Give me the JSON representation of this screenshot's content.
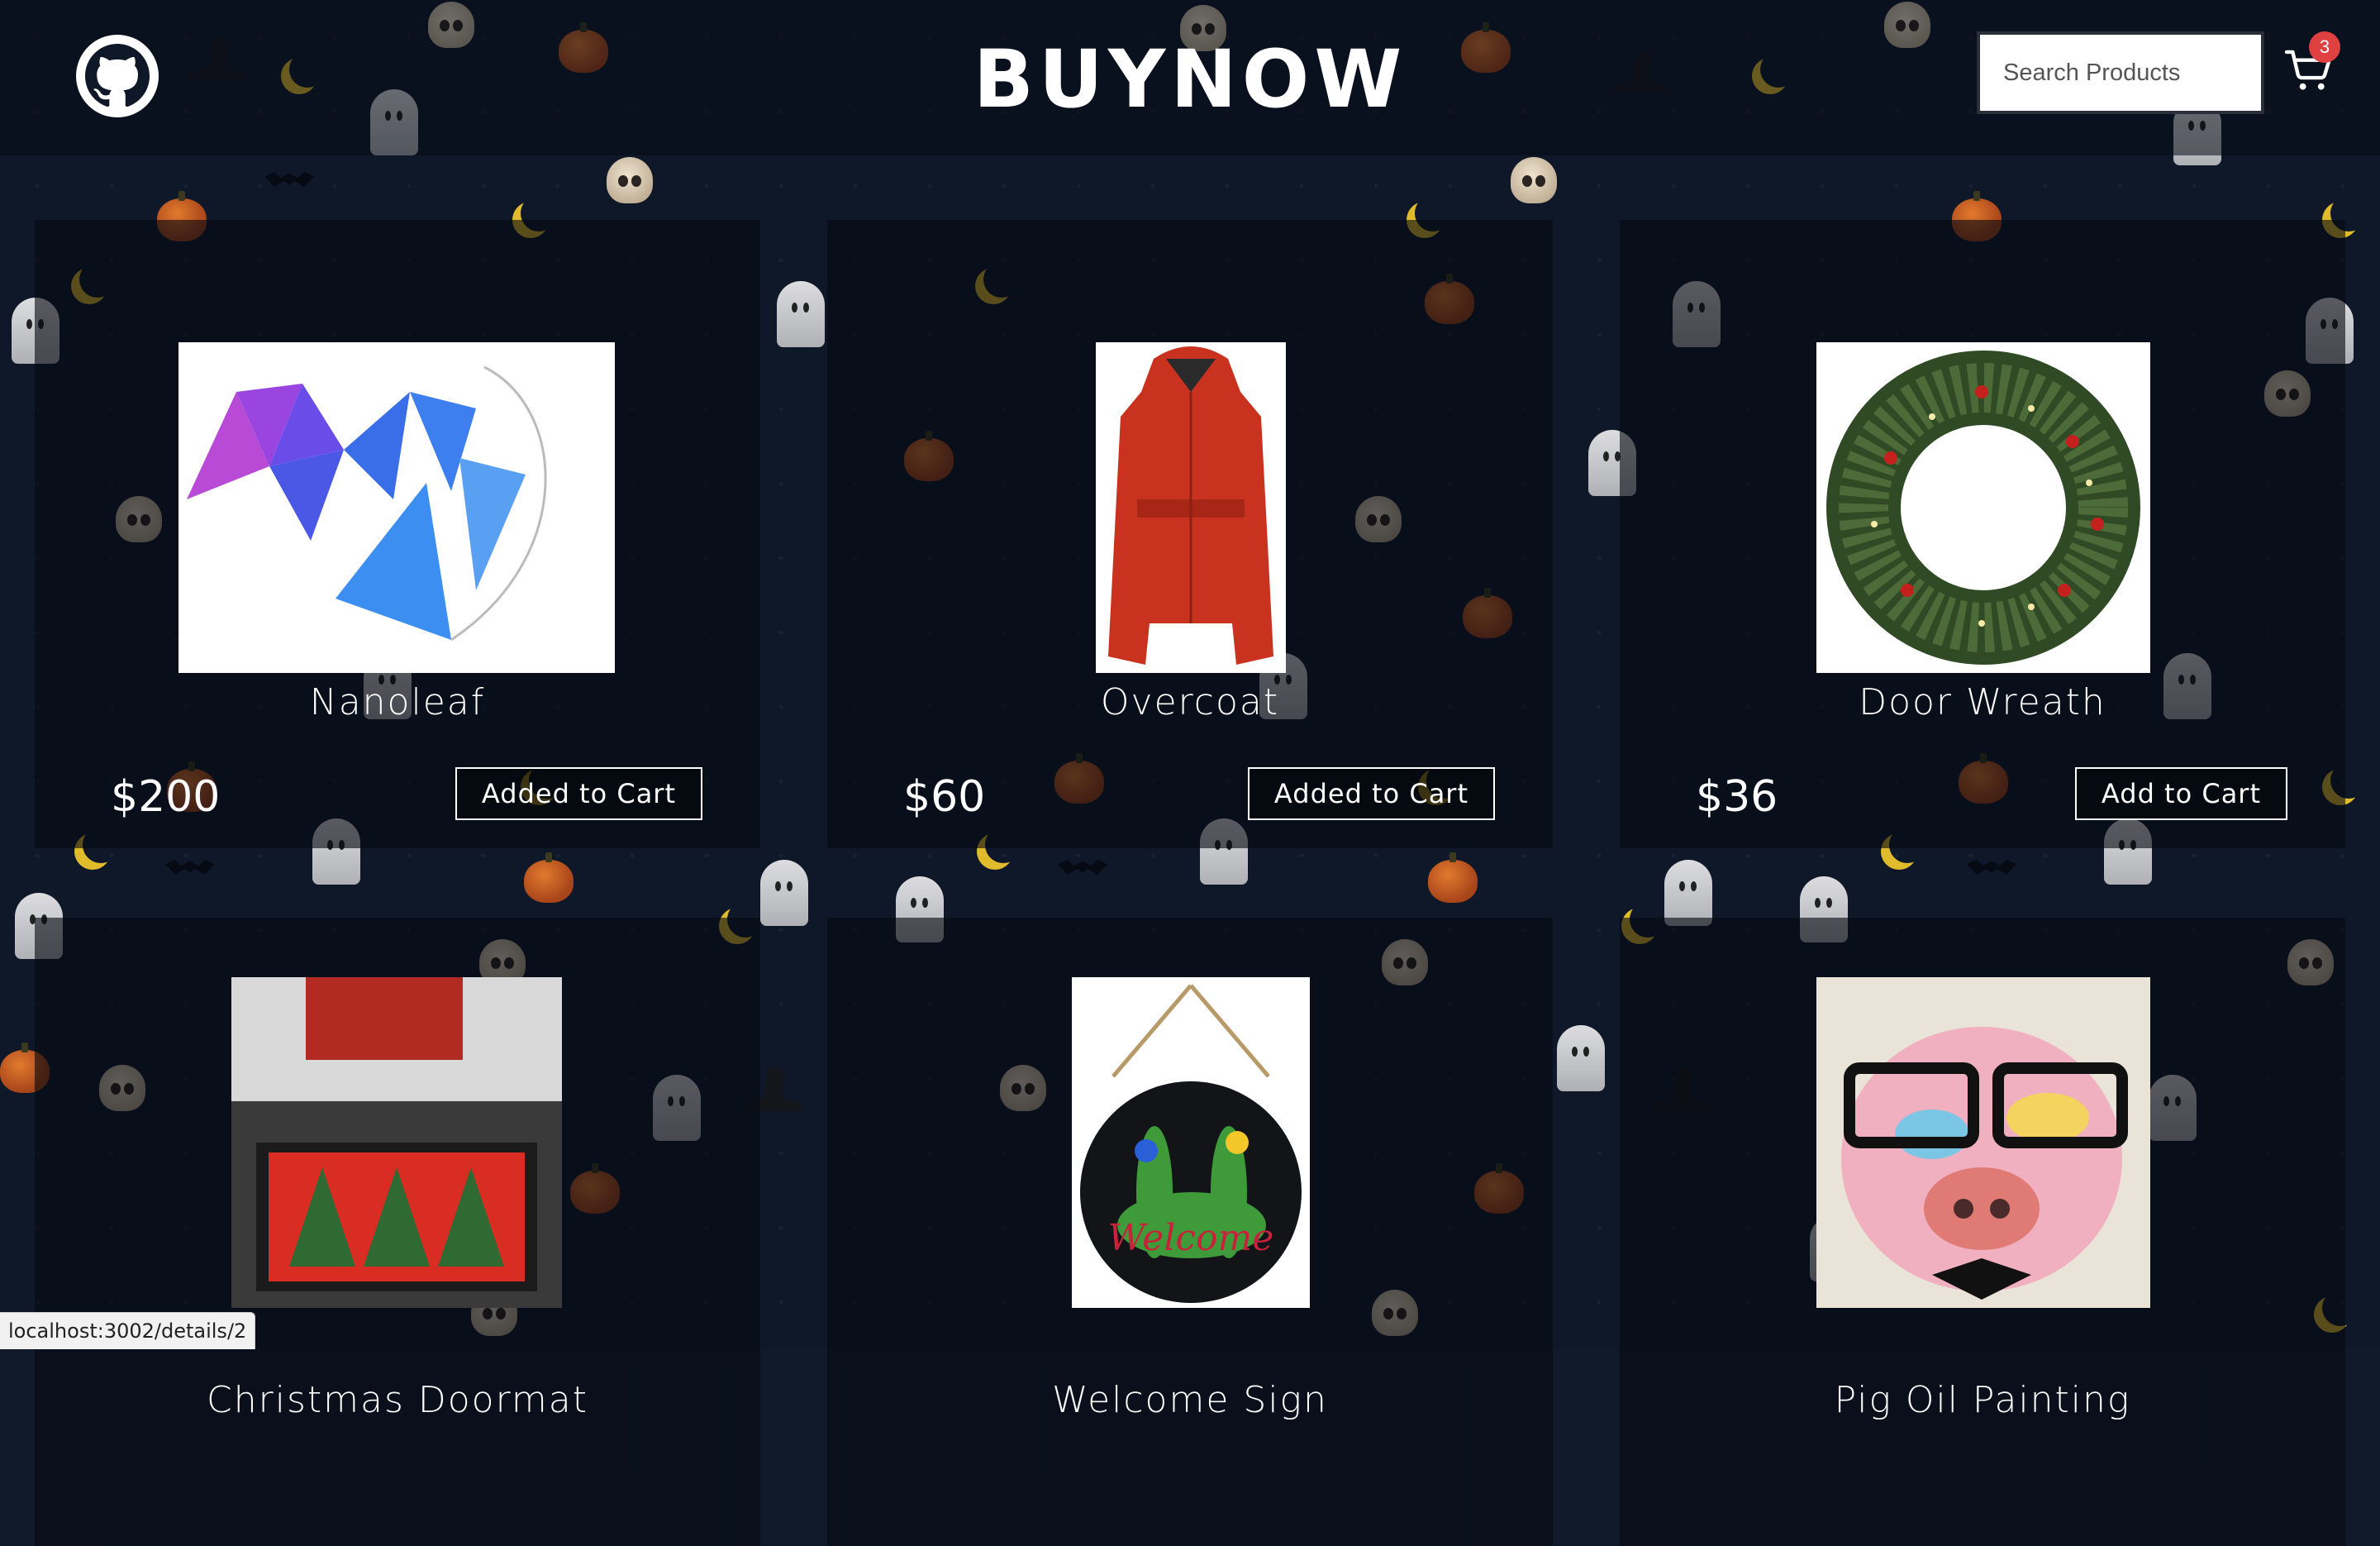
{
  "header": {
    "brand": "BUYNOW",
    "search_placeholder": "Search Products",
    "cart_count": "3",
    "github_icon": "github-icon",
    "cart_icon": "shopping-cart-icon"
  },
  "products": [
    {
      "name": "Nanoleaf",
      "price": "$200",
      "button": "Added to Cart"
    },
    {
      "name": "Overcoat",
      "price": "$60",
      "button": "Added to Cart"
    },
    {
      "name": "Door Wreath",
      "price": "$36",
      "button": "Add to Cart"
    },
    {
      "name": "Christmas Doormat",
      "price": "",
      "button": ""
    },
    {
      "name": "Welcome Sign",
      "price": "",
      "button": ""
    },
    {
      "name": "Pig Oil Painting",
      "price": "",
      "button": ""
    }
  ],
  "status_url": "localhost:3002/details/2",
  "colors": {
    "background": "#0f1828",
    "badge": "#e04040",
    "moon": "#e0bb2b",
    "pumpkin": "#c95f22"
  }
}
